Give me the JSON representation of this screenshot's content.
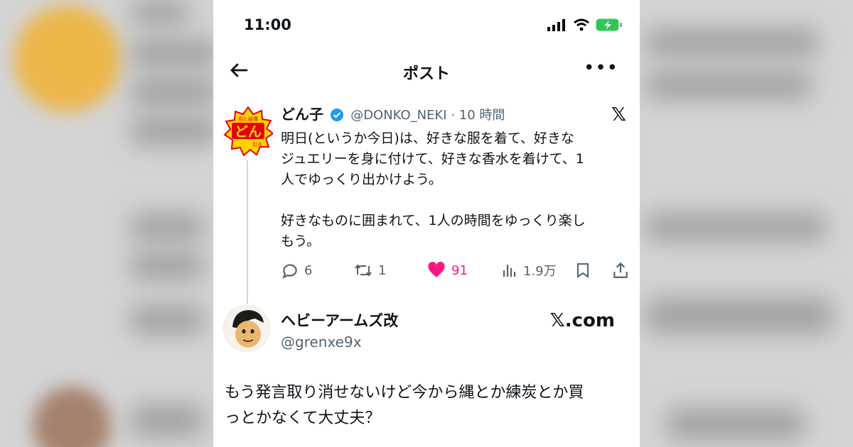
{
  "status_bar": {
    "time": "11:00"
  },
  "header": {
    "back_icon": "arrow-left-icon",
    "title": "ポスト",
    "more_label": "•••"
  },
  "post": {
    "author_name": "どん子",
    "handle_time": "@DONKO_NEKI · 10 時間",
    "avatar_text": "どん",
    "avatar_small_top": "割と結構",
    "avatar_small_bottom": "引き",
    "x_logo": "𝕏",
    "content_line1": "明日(というか今日)は、好きな服を着て、好きな",
    "content_line2": "ジュエリーを身に付けて、好きな香水を着けて、1",
    "content_line3": "人でゆっくり出かけよう。",
    "content_line4": "好きなものに囲まれて、1人の時間をゆっくり楽し",
    "content_line5": "もう。",
    "replies": "6",
    "retweets": "1",
    "likes": "91",
    "views": "1.9万"
  },
  "reply": {
    "author_name": "ヘビーアームズ改",
    "handle": "@grenxe9x",
    "domain": "𝕏.com",
    "text_line1": "もう発言取り消せないけど今から縄とか練炭とか買",
    "text_line2": "っとかなくて大丈夫？"
  },
  "colors": {
    "like": "#f91880",
    "verified": "#1d9bf0",
    "battery": "#31c759"
  }
}
